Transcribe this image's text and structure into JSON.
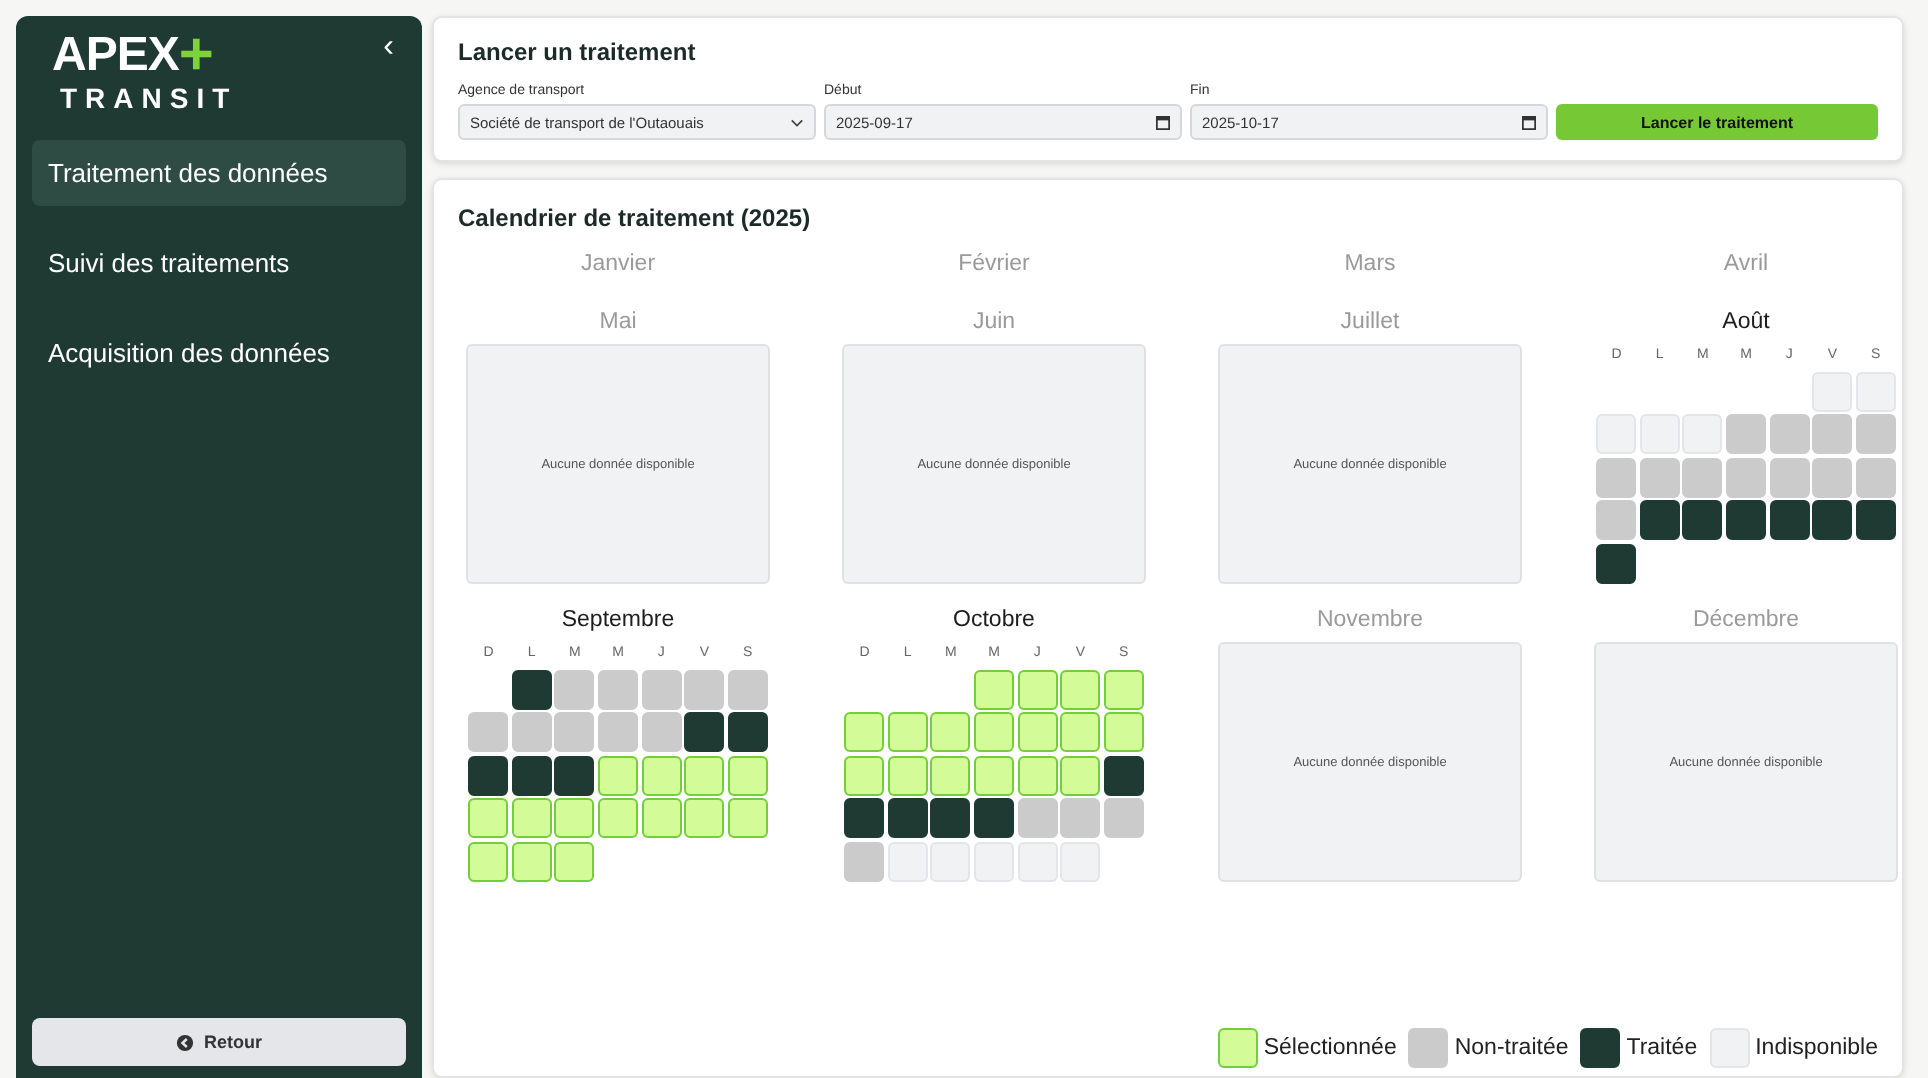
{
  "sidebar": {
    "logo_top": "APEX",
    "logo_plus": "+",
    "logo_bottom": "TRANSIT",
    "collapse": "‹",
    "items": [
      {
        "label": "Traitement des données",
        "selected": true
      },
      {
        "label": "Suivi des traitements",
        "selected": false
      },
      {
        "label": "Acquisition des données",
        "selected": false
      }
    ],
    "back_button": "Retour"
  },
  "launch": {
    "title": "Lancer un traitement",
    "agency": {
      "label": "Agence de transport",
      "value": "Société de transport de l'Outaouais"
    },
    "start": {
      "label": "Début",
      "value": "2025-09-17"
    },
    "end": {
      "label": "Fin",
      "value": "2025-10-17"
    },
    "button": "Lancer le traitement"
  },
  "calendar": {
    "title": "Calendrier de traitement (2025)",
    "months": [
      {
        "name": "Janvier",
        "kind": "none"
      },
      {
        "name": "Février",
        "kind": "none"
      },
      {
        "name": "Mars",
        "kind": "none"
      },
      {
        "name": "Avril",
        "kind": "none"
      },
      {
        "name": "Mai",
        "kind": "empty",
        "message": "Aucune donnée disponible"
      },
      {
        "name": "Juin",
        "kind": "empty",
        "message": "Aucune donnée disponible"
      },
      {
        "name": "Juillet",
        "kind": "empty",
        "message": "Aucune donnée disponible"
      },
      {
        "name": "Août",
        "kind": "grid",
        "weekdays": [
          "D",
          "L",
          "M",
          "M",
          "J",
          "V",
          "S"
        ],
        "weeks": [
          [
            {
              "kind": "blank"
            },
            {
              "kind": "blank"
            },
            {
              "kind": "blank"
            },
            {
              "kind": "blank"
            },
            {
              "kind": "blank"
            },
            {
              "kind": "unavailable"
            },
            {
              "kind": "unavailable"
            }
          ],
          [
            {
              "kind": "unavailable"
            },
            {
              "kind": "unavailable"
            },
            {
              "kind": "unavailable"
            },
            {
              "kind": "pending"
            },
            {
              "kind": "pending"
            },
            {
              "kind": "pending"
            },
            {
              "kind": "pending"
            }
          ],
          [
            {
              "kind": "pending"
            },
            {
              "kind": "pending"
            },
            {
              "kind": "pending"
            },
            {
              "kind": "pending"
            },
            {
              "kind": "pending"
            },
            {
              "kind": "pending"
            },
            {
              "kind": "pending"
            }
          ],
          [
            {
              "kind": "pending"
            },
            {
              "kind": "done"
            },
            {
              "kind": "done"
            },
            {
              "kind": "done"
            },
            {
              "kind": "done"
            },
            {
              "kind": "done"
            },
            {
              "kind": "done"
            }
          ],
          [
            {
              "kind": "done"
            }
          ]
        ]
      },
      {
        "name": "Septembre",
        "kind": "grid",
        "weekdays": [
          "D",
          "L",
          "M",
          "M",
          "J",
          "V",
          "S"
        ],
        "weeks": [
          [
            {
              "kind": "blank"
            },
            {
              "kind": "done"
            },
            {
              "kind": "pending"
            },
            {
              "kind": "pending"
            },
            {
              "kind": "pending"
            },
            {
              "kind": "pending"
            },
            {
              "kind": "pending"
            }
          ],
          [
            {
              "kind": "pending"
            },
            {
              "kind": "pending"
            },
            {
              "kind": "pending"
            },
            {
              "kind": "pending"
            },
            {
              "kind": "pending"
            },
            {
              "kind": "done"
            },
            {
              "kind": "done"
            }
          ],
          [
            {
              "kind": "done"
            },
            {
              "kind": "done"
            },
            {
              "kind": "done"
            },
            {
              "kind": "selected"
            },
            {
              "kind": "selected"
            },
            {
              "kind": "selected"
            },
            {
              "kind": "selected"
            }
          ],
          [
            {
              "kind": "selected"
            },
            {
              "kind": "selected"
            },
            {
              "kind": "selected"
            },
            {
              "kind": "selected"
            },
            {
              "kind": "selected"
            },
            {
              "kind": "selected"
            },
            {
              "kind": "selected"
            }
          ],
          [
            {
              "kind": "selected"
            },
            {
              "kind": "selected"
            },
            {
              "kind": "selected"
            }
          ]
        ]
      },
      {
        "name": "Octobre",
        "kind": "grid",
        "weekdays": [
          "D",
          "L",
          "M",
          "M",
          "J",
          "V",
          "S"
        ],
        "weeks": [
          [
            {
              "kind": "blank"
            },
            {
              "kind": "blank"
            },
            {
              "kind": "blank"
            },
            {
              "kind": "selected"
            },
            {
              "kind": "selected"
            },
            {
              "kind": "selected"
            },
            {
              "kind": "selected"
            }
          ],
          [
            {
              "kind": "selected"
            },
            {
              "kind": "selected"
            },
            {
              "kind": "selected"
            },
            {
              "kind": "selected"
            },
            {
              "kind": "selected"
            },
            {
              "kind": "selected"
            },
            {
              "kind": "selected"
            }
          ],
          [
            {
              "kind": "selected"
            },
            {
              "kind": "selected"
            },
            {
              "kind": "selected"
            },
            {
              "kind": "selected"
            },
            {
              "kind": "selected"
            },
            {
              "kind": "selected"
            },
            {
              "kind": "done"
            }
          ],
          [
            {
              "kind": "done"
            },
            {
              "kind": "done"
            },
            {
              "kind": "done"
            },
            {
              "kind": "done"
            },
            {
              "kind": "pending"
            },
            {
              "kind": "pending"
            },
            {
              "kind": "pending"
            }
          ],
          [
            {
              "kind": "pending"
            },
            {
              "kind": "unavailable"
            },
            {
              "kind": "unavailable"
            },
            {
              "kind": "unavailable"
            },
            {
              "kind": "unavailable"
            },
            {
              "kind": "unavailable"
            }
          ]
        ]
      },
      {
        "name": "Novembre",
        "kind": "empty",
        "message": "Aucune donnée disponible"
      },
      {
        "name": "Décembre",
        "kind": "empty",
        "message": "Aucune donnée disponible"
      }
    ],
    "legend": [
      {
        "label": "Sélectionnée",
        "kind": "selected"
      },
      {
        "label": "Non-traitée",
        "kind": "pending"
      },
      {
        "label": "Traitée",
        "kind": "done"
      },
      {
        "label": "Indisponible",
        "kind": "unavailable"
      }
    ]
  }
}
